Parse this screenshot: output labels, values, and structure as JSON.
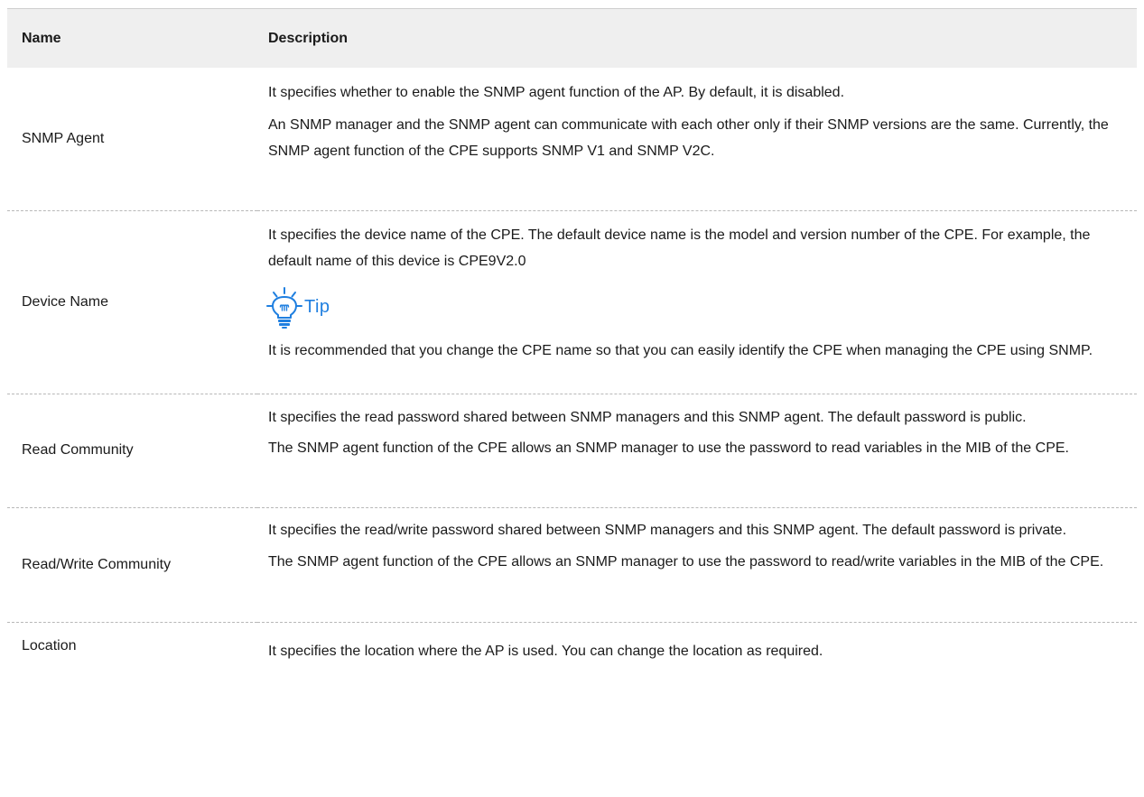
{
  "table": {
    "headers": {
      "name": "Name",
      "description": "Description"
    },
    "rows": [
      {
        "name": "SNMP Agent",
        "paragraphs": [
          "It specifies whether to enable the SNMP agent function of the AP. By default, it is disabled.",
          "An SNMP manager and the SNMP agent can communicate with each other only if their SNMP versions are the same. Currently, the SNMP agent function of the CPE supports SNMP V1 and SNMP V2C."
        ]
      },
      {
        "name": "Device Name",
        "paragraphs": [
          "It specifies the device name of the CPE. The default device name is the model and version number of the CPE. For example, the default name of this device is CPE9V2.0"
        ],
        "tip": {
          "icon": "lightbulb-icon",
          "label": "Tip",
          "color": "#1f7fe0",
          "text": "It is recommended that you change the CPE name so that you can easily identify the CPE when managing the CPE using SNMP."
        }
      },
      {
        "name": "Read Community",
        "paragraphs": [
          "It specifies the read password shared between SNMP managers and this SNMP agent. The default password is public.",
          "The SNMP agent function of the CPE allows an SNMP manager to use the password to read variables in the MIB of the CPE."
        ]
      },
      {
        "name": "Read/Write Community",
        "paragraphs": [
          "It specifies the read/write password shared between SNMP managers and this SNMP agent. The default password is private.",
          "The SNMP agent function of the CPE allows an SNMP manager to use the password to read/write variables in the MIB of the CPE."
        ]
      },
      {
        "name": "Location",
        "paragraphs": [
          "It specifies the location where the AP is used. You can change the location as required."
        ]
      }
    ]
  }
}
